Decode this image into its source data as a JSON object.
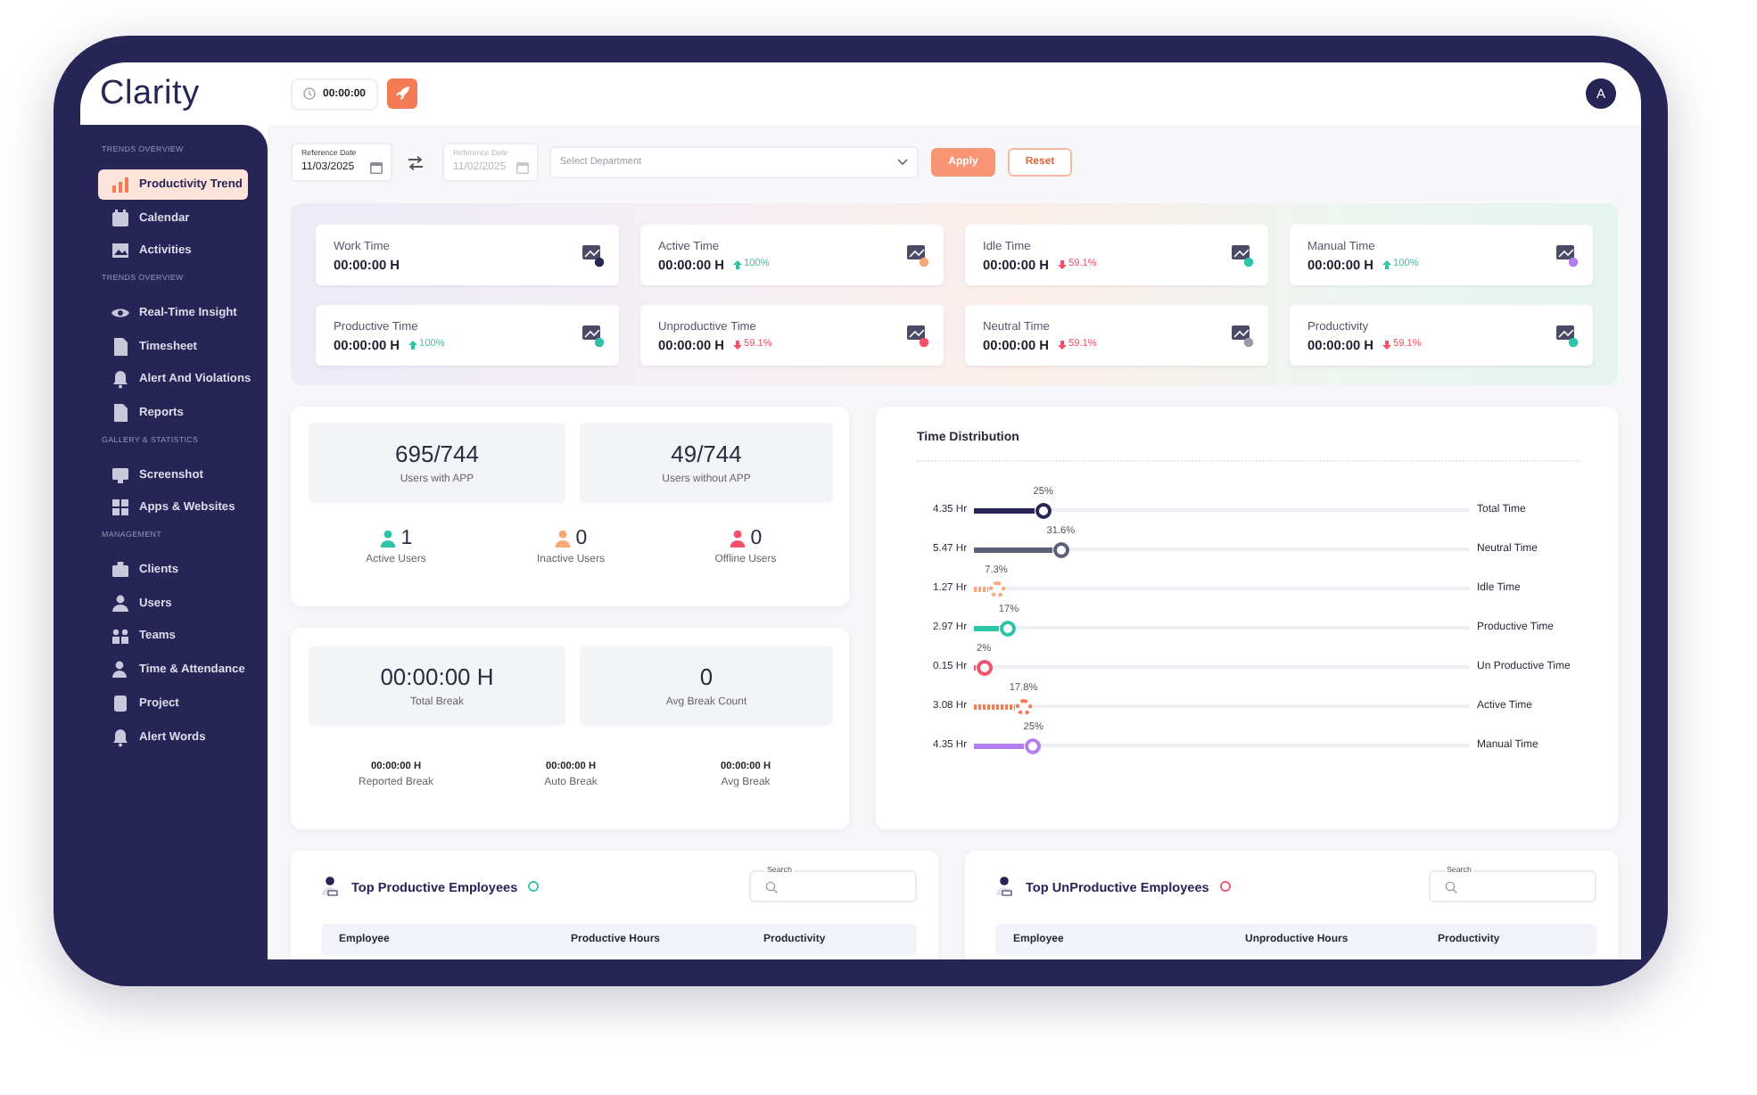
{
  "app": {
    "logo": "Clarity",
    "timer": "00:00:00",
    "avatar": "A"
  },
  "sidebar": {
    "sections": [
      {
        "title": "TRENDS OVERVIEW",
        "items": [
          {
            "label": "Productivity Trend",
            "selected": true
          },
          {
            "label": "Calendar",
            "selected": false
          },
          {
            "label": "Activities",
            "selected": false
          }
        ]
      },
      {
        "title": "TRENDS OVERVIEW",
        "items": [
          {
            "label": "Real-Time Insight",
            "selected": false
          },
          {
            "label": "Timesheet",
            "selected": false
          },
          {
            "label": "Alert And Violations",
            "selected": false
          },
          {
            "label": "Reports",
            "selected": false
          }
        ]
      },
      {
        "title": "GALLERY & STATISTICS",
        "items": [
          {
            "label": "Screenshot",
            "selected": false
          },
          {
            "label": "Apps & Websites",
            "selected": false
          }
        ]
      },
      {
        "title": "MANAGEMENT",
        "items": [
          {
            "label": "Clients",
            "selected": false
          },
          {
            "label": "Users",
            "selected": false
          },
          {
            "label": "Teams",
            "selected": false
          },
          {
            "label": "Time & Attendance",
            "selected": false
          },
          {
            "label": "Project",
            "selected": false
          },
          {
            "label": "Alert Words",
            "selected": false
          }
        ]
      }
    ]
  },
  "filters": {
    "reference_date": {
      "label": "Reference Date",
      "value": "11/03/2025",
      "disabled": false
    },
    "compare_date": {
      "label": "Reference Date",
      "value": "11/02/2025",
      "disabled": true
    },
    "department": {
      "placeholder": "Select Department"
    },
    "buttons": [
      {
        "label": "Apply",
        "kind": "primary"
      },
      {
        "label": "Reset",
        "kind": "outline"
      }
    ]
  },
  "stats": [
    {
      "label": "Work Time",
      "value": "00:00:00 H",
      "color": "#272556"
    },
    {
      "label": "Active Time",
      "value": "00:00:00 H",
      "color": "#f9a77a",
      "delta": {
        "text": "100%",
        "kind": "up"
      }
    },
    {
      "label": "Idle Time",
      "value": "00:00:00 H",
      "color": "#2ec4a6",
      "delta": {
        "text": "59.1%",
        "kind": "down"
      }
    },
    {
      "label": "Manual Time",
      "value": "00:00:00 H",
      "color": "#b47ef0",
      "delta": {
        "text": "100%",
        "kind": "up"
      }
    },
    {
      "label": "Productive Time",
      "value": "00:00:00 H",
      "color": "#2ec4a6",
      "delta": {
        "text": "100%",
        "kind": "up"
      }
    },
    {
      "label": "Unproductive Time",
      "value": "00:00:00 H",
      "color": "#f2506b",
      "delta": {
        "text": "59.1%",
        "kind": "down"
      }
    },
    {
      "label": "Neutral Time",
      "value": "00:00:00 H",
      "color": "#9a9aa8",
      "delta": {
        "text": "59.1%",
        "kind": "down"
      }
    },
    {
      "label": "Productivity",
      "value": "00:00:00 H",
      "color": "#2ec4a6",
      "delta": {
        "text": "59.1%",
        "kind": "down"
      }
    }
  ],
  "users": {
    "totals": [
      {
        "value": "695/744",
        "label": "Users with APP"
      },
      {
        "value": "49/744",
        "label": "Users without APP"
      }
    ],
    "statuses": [
      {
        "count": "1",
        "label": "Active Users",
        "color": "#2ec4a6"
      },
      {
        "count": "0",
        "label": "Inactive Users",
        "color": "#f9a77a"
      },
      {
        "count": "0",
        "label": "Offline Users",
        "color": "#f2506b"
      }
    ]
  },
  "breaks": {
    "totals": [
      {
        "value": "00:00:00 H",
        "label": "Total Break"
      },
      {
        "value": "0",
        "label": "Avg Break Count"
      }
    ],
    "details": [
      {
        "value": "00:00:00 H",
        "label": "Reported Break"
      },
      {
        "value": "00:00:00 H",
        "label": "Auto Break"
      },
      {
        "value": "00:00:00 H",
        "label": "Avg Break"
      }
    ]
  },
  "time_distribution": {
    "title": "Time Distribution",
    "rows": [
      {
        "hours": "4.35 Hr",
        "percent": "25%",
        "label": "Total Time",
        "level": 0.14,
        "color": "#272556",
        "dashed": false
      },
      {
        "hours": "5.47 Hr",
        "percent": "31.6%",
        "label": "Neutral Time",
        "level": 0.175,
        "color": "#5b6078",
        "dashed": false
      },
      {
        "hours": "1.27 Hr",
        "percent": "7.3%",
        "label": "Idle Time",
        "level": 0.045,
        "color": "#f9a77a",
        "dashed": true
      },
      {
        "hours": "2.97 Hr",
        "percent": "17%",
        "label": "Productive Time",
        "level": 0.07,
        "color": "#2ec4a6",
        "dashed": false
      },
      {
        "hours": "0.15 Hr",
        "percent": "2%",
        "label": "Un Productive Time",
        "level": 0.02,
        "color": "#f2506b",
        "dashed": false
      },
      {
        "hours": "3.08 Hr",
        "percent": "17.8%",
        "label": "Active Time",
        "level": 0.1,
        "color": "#f47c54",
        "dashed": true
      },
      {
        "hours": "4.35 Hr",
        "percent": "25%",
        "label": "Manual Time",
        "level": 0.12,
        "color": "#b47ef0",
        "dashed": false
      }
    ]
  },
  "tables": [
    {
      "title": "Top Productive Employees",
      "color": "#2ec4a6",
      "search": {
        "label": "Search"
      },
      "columns": [
        "Employee",
        "Productive Hours",
        "Productivity"
      ]
    },
    {
      "title": "Top UnProductive Employees",
      "color": "#f2506b",
      "search": {
        "label": "Search"
      },
      "columns": [
        "Employee",
        "Unproductive Hours",
        "Productivity"
      ]
    }
  ]
}
